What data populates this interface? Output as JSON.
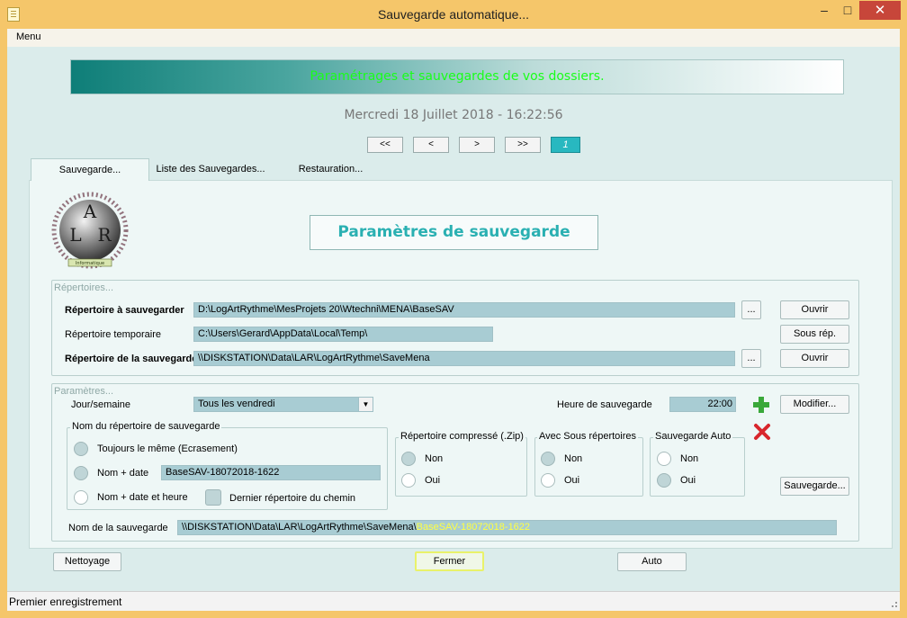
{
  "window": {
    "title": "Sauvegarde automatique...",
    "minimize": "–",
    "maximize": "□",
    "close": "✕"
  },
  "menu": {
    "label": "Menu"
  },
  "banner": {
    "text": "Paramétrages et sauvegardes de vos dossiers."
  },
  "date_line": "Mercredi 18 Juillet 2018   -   16:22:56",
  "nav": {
    "first": "<<",
    "prev": "<",
    "next": ">",
    "last": ">>",
    "page": "1"
  },
  "tabs": [
    {
      "label": "Sauvegarde..."
    },
    {
      "label": "Liste des Sauvegardes..."
    },
    {
      "label": "Restauration..."
    }
  ],
  "params_title": "Paramètres de sauvegarde",
  "repertoires": {
    "title": "Répertoires...",
    "src_label": "Répertoire à sauvegarder",
    "src_value": "D:\\LogArtRythme\\MesProjets 20\\Wtechni\\MENA\\BaseSAV",
    "tmp_label": "Répertoire temporaire",
    "tmp_value": "C:\\Users\\Gerard\\AppData\\Local\\Temp\\",
    "dst_label": "Répertoire de la sauvegarde",
    "dst_value": "\\\\DISKSTATION\\Data\\LAR\\LogArtRythme\\SaveMena",
    "browse_label": "...",
    "open_label": "Ouvrir",
    "sous_rep_label": "Sous rép."
  },
  "parametres": {
    "title": "Paramètres...",
    "jour_label": "Jour/semaine",
    "jour_value": "Tous les vendredi",
    "heure_label": "Heure de sauvegarde",
    "heure_value": "22:00",
    "modifier_label": "Modifier...",
    "nom_rep_title": "Nom du répertoire de sauvegarde",
    "opt_same": "Toujours le même (Ecrasement)",
    "opt_date": "Nom + date",
    "opt_date_value": "BaseSAV-18072018-1622",
    "opt_datetime": "Nom + date et heure",
    "dernier_rep": "Dernier répertoire du chemin",
    "zip_title": "Répertoire compressé (.Zip)",
    "sous_title": "Avec Sous répertoires",
    "auto_title": "Sauvegarde Auto",
    "non": "Non",
    "oui": "Oui",
    "sauvegarde_btn": "Sauvegarde...",
    "nom_sauv_label": "Nom de la sauvegarde",
    "nom_sauv_path": "\\\\DISKSTATION\\Data\\LAR\\LogArtRythme\\SaveMena\\",
    "nom_sauv_name": "BaseSAV-18072018-1622"
  },
  "bottom": {
    "nettoyage": "Nettoyage",
    "fermer": "Fermer",
    "auto": "Auto"
  },
  "logo": {
    "letters": [
      "A",
      "L",
      "R"
    ],
    "caption": "Informatique"
  },
  "status": {
    "text": "Premier enregistrement"
  },
  "colors": {
    "accent": "#2ab0b2",
    "banner_text": "#19ff19",
    "field": "#a8ccd3",
    "titlebar": "#f5c66a"
  }
}
